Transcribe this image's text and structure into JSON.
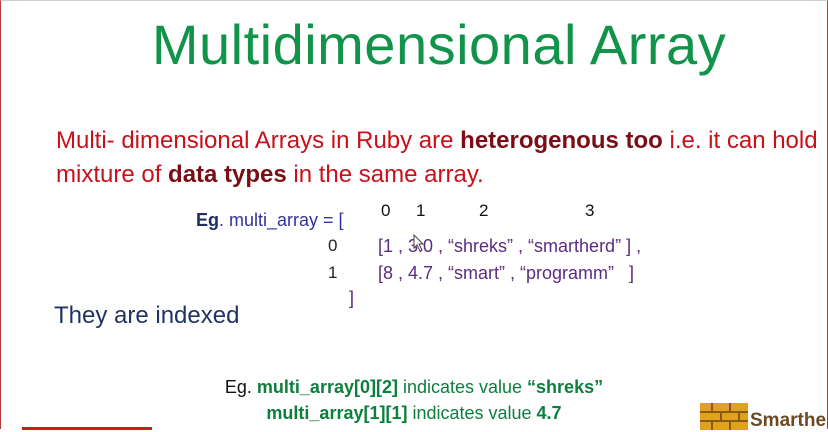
{
  "title": "Multidimensional Array",
  "description": {
    "part1": "Multi- dimensional Arrays in Ruby are ",
    "bold1": "heterogenous too",
    "part2": " i.e. it can hold mixture of ",
    "bold2": "data types",
    "part3": " in the same array."
  },
  "example": {
    "eg": "Eg",
    "decl": ". multi_array = [",
    "column_indices": [
      "0",
      "1",
      "2",
      "3"
    ],
    "row_indices": [
      "0",
      "1"
    ],
    "rows": [
      "[1 , 3.0 , “shreks” , “smartherd” ] ,",
      "[8 , 4.7 , “smart” , “programm”   ]"
    ],
    "closing": "]"
  },
  "indexed_text": "They are indexed",
  "notes": [
    {
      "prefix": "Eg. ",
      "code": "multi_array[0][2]",
      "mid": " indicates value ",
      "value": "“shreks”"
    },
    {
      "prefix": "",
      "code": "multi_array[1][1]",
      "mid": " indicates  value ",
      "value": "4.7"
    }
  ],
  "logo_text": "Smarther",
  "colors": {
    "title": "#119349",
    "description": "#c8101a",
    "array": "#5b2c83",
    "note_code": "#0d7f3d"
  }
}
